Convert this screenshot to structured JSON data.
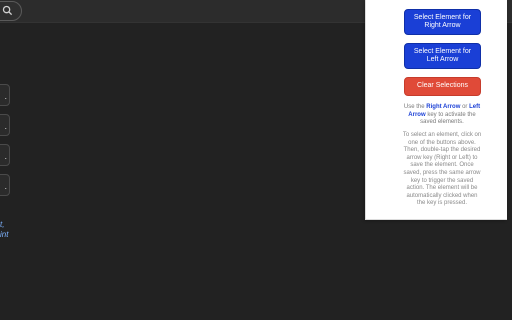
{
  "background": {
    "page_color": "#222222",
    "topbar_color": "#2c2c2c"
  },
  "sidebar": {
    "items": [
      {
        "label": "."
      },
      {
        "label": "."
      },
      {
        "label": "."
      },
      {
        "label": "."
      }
    ],
    "partial_text_line1": "t,",
    "partial_text_line2": "int"
  },
  "search": {
    "icon": "search-icon"
  },
  "panel": {
    "buttons": {
      "right_arrow": "Select Element for Right Arrow",
      "left_arrow": "Select Element for Left Arrow",
      "clear": "Clear Selections"
    },
    "usage": {
      "prefix": "Use the",
      "right_key": "Right Arrow",
      "or": "or",
      "left_key": "Left Arrow",
      "suffix": "key to activate the saved elements."
    },
    "instructions": "To select an element, click on one of the buttons above. Then, double-tap the desired arrow key (Right or Left) to save the element. Once saved, press the same arrow key to trigger the saved action. The element will be automatically clicked when the key is pressed.",
    "colors": {
      "primary": "#1a3fd6",
      "danger": "#e04a38"
    }
  }
}
